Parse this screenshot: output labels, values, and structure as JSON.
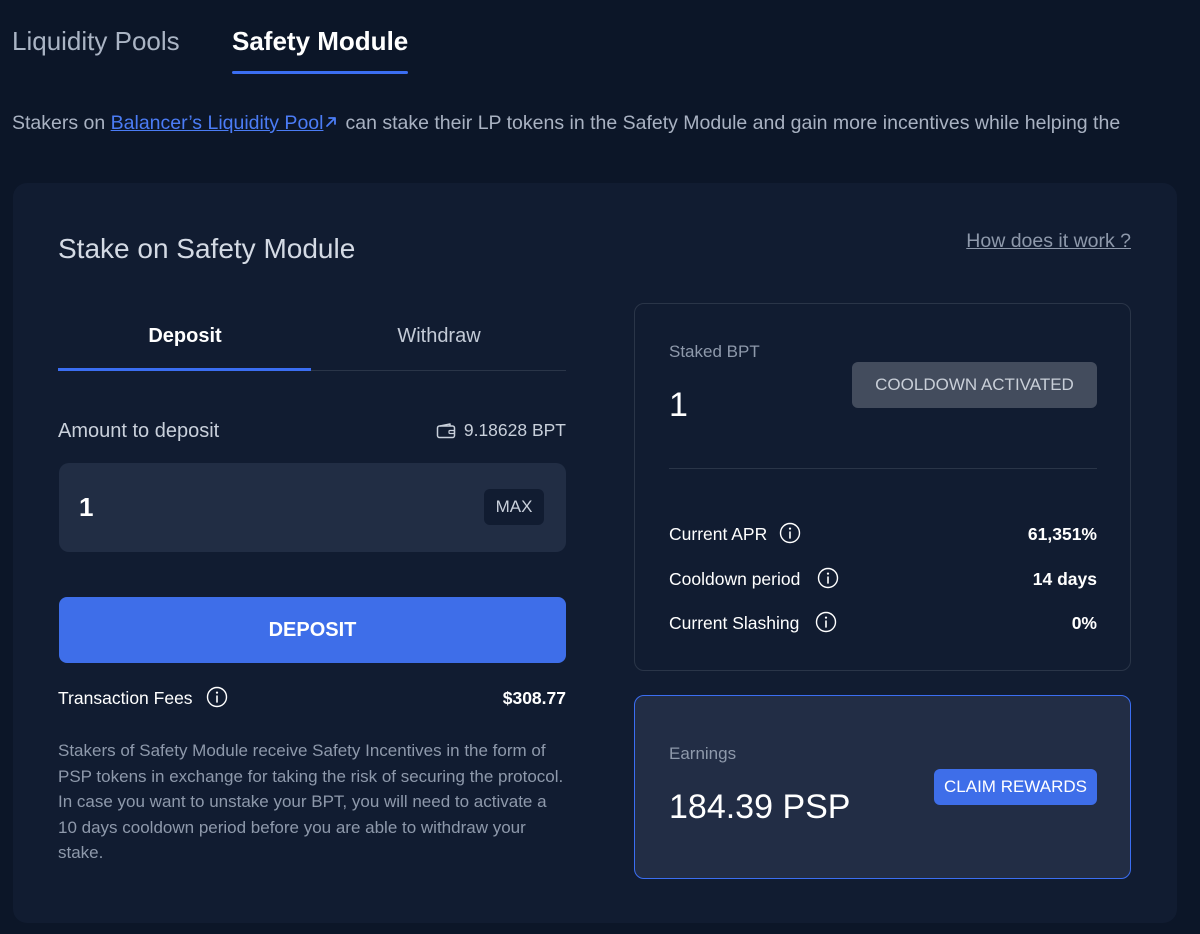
{
  "top_tabs": [
    {
      "label": "Liquidity Pools"
    },
    {
      "label": "Safety Module"
    }
  ],
  "intro": {
    "prefix": "Stakers on ",
    "link": "Balancer’s Liquidity Pool",
    "suffix": "can stake their LP tokens in the Safety Module and gain more incentives while helping the"
  },
  "card": {
    "title": "Stake on Safety Module",
    "how_link": "How does it work ?"
  },
  "deposit_tabs": [
    {
      "label": "Deposit"
    },
    {
      "label": "Withdraw"
    }
  ],
  "form": {
    "amount_label": "Amount to deposit",
    "balance": "9.18628 BPT",
    "amount_value": "1",
    "max_label": "MAX",
    "deposit_button": "DEPOSIT",
    "fees_label": "Transaction Fees",
    "fees_value": "$308.77",
    "description": "Stakers of Safety Module receive Safety Incentives in the form of PSP tokens in exchange for taking the risk of securing the protocol. In case you want to unstake your BPT, you will need to activate a 10 days cooldown period before you are able to withdraw your stake."
  },
  "staked": {
    "label": "Staked BPT",
    "value": "1",
    "cooldown_button": "COOLDOWN ACTIVATED",
    "stats": [
      {
        "label": "Current APR",
        "value": "61,351%"
      },
      {
        "label": "Cooldown period",
        "value": "14 days"
      },
      {
        "label": "Current Slashing",
        "value": "0%"
      }
    ]
  },
  "earnings": {
    "label": "Earnings",
    "value": "184.39 PSP",
    "claim_button": "CLAIM REWARDS"
  },
  "colors": {
    "background": "#0c1628",
    "card": "#111c31",
    "accent": "#3e6ee9",
    "link": "#4b7cf5"
  }
}
